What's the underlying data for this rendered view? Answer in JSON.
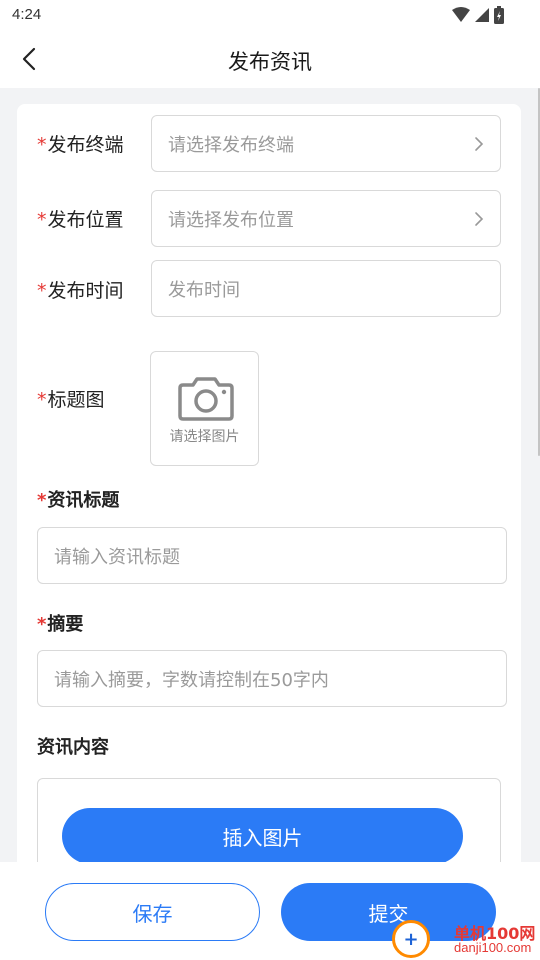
{
  "status_bar": {
    "time": "4:24"
  },
  "nav": {
    "title": "发布资讯"
  },
  "form": {
    "required_mark": "*",
    "terminal": {
      "label": "发布终端",
      "placeholder": "请选择发布终端"
    },
    "position": {
      "label": "发布位置",
      "placeholder": "请选择发布位置"
    },
    "time": {
      "label": "发布时间",
      "placeholder": "发布时间"
    },
    "cover": {
      "label": "标题图",
      "caption": "请选择图片"
    },
    "news_title": {
      "label": "资讯标题",
      "placeholder": "请输入资讯标题"
    },
    "summary": {
      "label": "摘要",
      "placeholder": "请输入摘要，字数请控制在50字内"
    },
    "content": {
      "label": "资讯内容",
      "insert_image_label": "插入图片"
    }
  },
  "actions": {
    "save_label": "保存",
    "submit_label": "提交"
  },
  "watermark": {
    "name": "单机100网",
    "url": "danji100.com",
    "logo_text": "+"
  },
  "colors": {
    "primary": "#2b7bf6",
    "required": "#e53935",
    "placeholder": "#9a9a9a",
    "border": "#d9d9d9",
    "background": "#f2f3f5"
  }
}
